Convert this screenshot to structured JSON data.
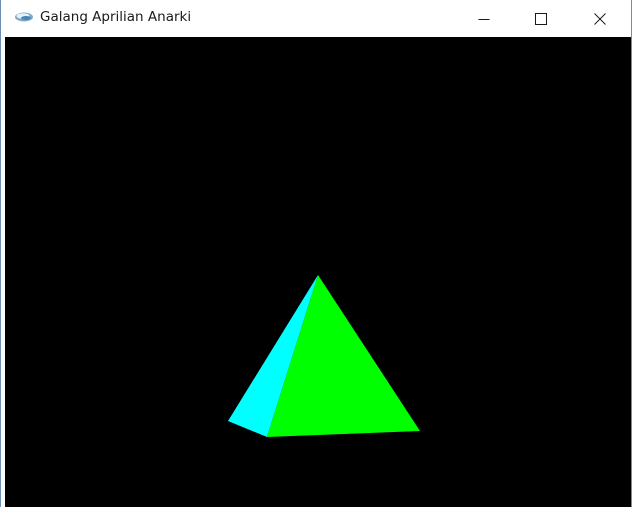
{
  "window": {
    "title": "Galang Aprilian Anarki",
    "icon": "glut-app-icon"
  },
  "controls": {
    "minimize_icon": "minimize-icon",
    "maximize_icon": "maximize-icon",
    "close_icon": "close-icon"
  },
  "scene": {
    "background": "#000000",
    "shape": "pyramid",
    "face_colors": {
      "left_face": "#00ffff",
      "front_face": "#00ff00"
    }
  }
}
